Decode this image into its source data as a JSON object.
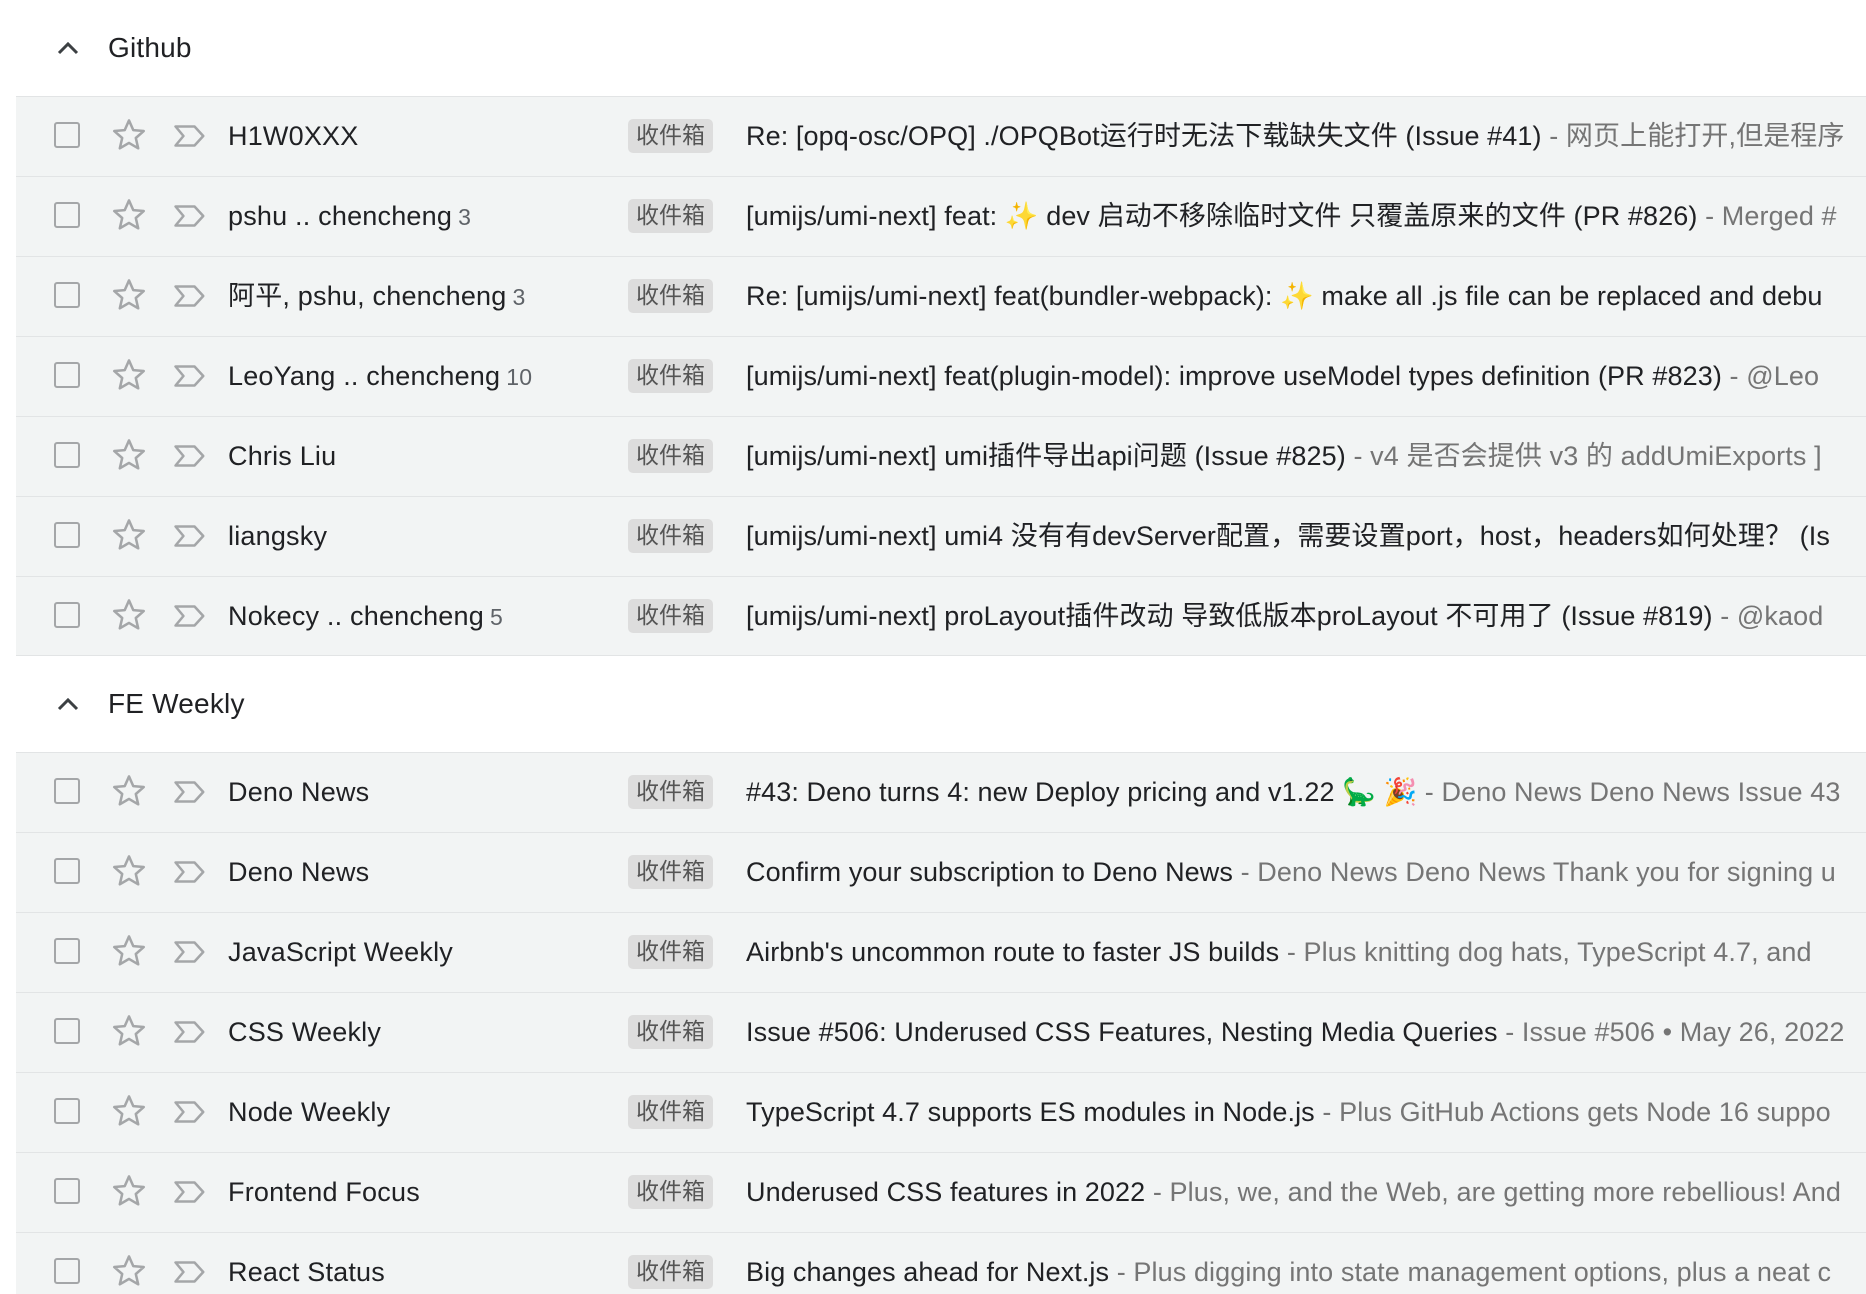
{
  "badge_label": "收件箱",
  "snippet_separator": " - ",
  "colors": {
    "row_background": "#f2f4f4",
    "divider": "#e2e4e5",
    "text_primary": "#202124",
    "text_snippet": "#757575",
    "badge_background": "#dddddd",
    "icon_gray": "#a4a6a8"
  },
  "icons": {
    "collapse": "chevron-up-icon",
    "checkbox": "checkbox-icon",
    "star": "star-outline-icon",
    "important": "important-marker-icon"
  },
  "sections": [
    {
      "title": "Github",
      "rows": [
        {
          "sender": "H1W0XXX",
          "count": "",
          "subject": "Re: [opq-osc/OPQ] ./OPQBot运行时无法下载缺失文件 (Issue #41)",
          "snippet": "网页上能打开,但是程序"
        },
        {
          "sender": "pshu .. chencheng",
          "count": "3",
          "subject": "[umijs/umi-next] feat: ✨ dev 启动不移除临时文件 只覆盖原来的文件 (PR #826)",
          "snippet": "Merged #"
        },
        {
          "sender": "阿平, pshu, chencheng",
          "count": "3",
          "subject": "Re: [umijs/umi-next] feat(bundler-webpack): ✨ make all .js file can be replaced and debu",
          "snippet": ""
        },
        {
          "sender": "LeoYang .. chencheng",
          "count": "10",
          "subject": "[umijs/umi-next] feat(plugin-model): improve useModel types definition (PR #823)",
          "snippet": "@Leo"
        },
        {
          "sender": "Chris Liu",
          "count": "",
          "subject": "[umijs/umi-next] umi插件导出api问题 (Issue #825)",
          "snippet": "v4 是否会提供 v3 的 addUmiExports ]"
        },
        {
          "sender": "liangsky",
          "count": "",
          "subject": "[umijs/umi-next] umi4 没有有devServer配置，需要设置port，host，headers如何处理？ (Is",
          "snippet": ""
        },
        {
          "sender": "Nokecy .. chencheng",
          "count": "5",
          "subject": "[umijs/umi-next] proLayout插件改动 导致低版本proLayout 不可用了 (Issue #819)",
          "snippet": "@kaod"
        }
      ]
    },
    {
      "title": "FE Weekly",
      "rows": [
        {
          "sender": "Deno News",
          "count": "",
          "subject": "#43: Deno turns 4: new Deploy pricing and v1.22 🦕 🎉",
          "snippet": "Deno News Deno News Issue 43"
        },
        {
          "sender": "Deno News",
          "count": "",
          "subject": "Confirm your subscription to Deno News",
          "snippet": "Deno News Deno News Thank you for signing u"
        },
        {
          "sender": "JavaScript Weekly",
          "count": "",
          "subject": "Airbnb's uncommon route to faster JS builds",
          "snippet": "Plus knitting dog hats, TypeScript 4.7, and"
        },
        {
          "sender": "CSS Weekly",
          "count": "",
          "subject": "Issue #506: Underused CSS Features, Nesting Media Queries",
          "snippet": "Issue #506 • May 26, 2022"
        },
        {
          "sender": "Node Weekly",
          "count": "",
          "subject": "TypeScript 4.7 supports ES modules in Node.js",
          "snippet": "Plus GitHub Actions gets Node 16 suppo"
        },
        {
          "sender": "Frontend Focus",
          "count": "",
          "subject": "Underused CSS features in 2022",
          "snippet": "Plus, we, and the Web, are getting more rebellious! And"
        },
        {
          "sender": "React Status",
          "count": "",
          "subject": "Big changes ahead for Next.js",
          "snippet": "Plus digging into state management options, plus a neat c"
        }
      ]
    }
  ]
}
